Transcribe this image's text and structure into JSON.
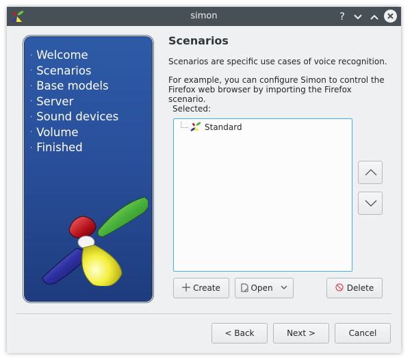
{
  "window": {
    "title": "simon"
  },
  "titlebar": {
    "help": "?",
    "minimize": "⌄",
    "maximize": "⌃",
    "close": "✕"
  },
  "wizard": {
    "steps": [
      "Welcome",
      "Scenarios",
      "Base models",
      "Server",
      "Sound devices",
      "Volume",
      "Finished"
    ],
    "step_bullet": "·"
  },
  "page": {
    "heading": "Scenarios",
    "intro": "Scenarios are specific use cases of voice recognition.",
    "example": "For example, you can configure Simon to control the Firefox web browser by importing the Firefox scenario.",
    "selected_label": "Selected:"
  },
  "scenarios": [
    "Standard"
  ],
  "buttons": {
    "create": "Create",
    "open": "Open",
    "delete": "Delete",
    "back": "< Back",
    "next": "Next >",
    "cancel": "Cancel"
  },
  "colors": {
    "titlebar": "#475057",
    "banner": "#2a509b",
    "focus": "#3daee9"
  }
}
